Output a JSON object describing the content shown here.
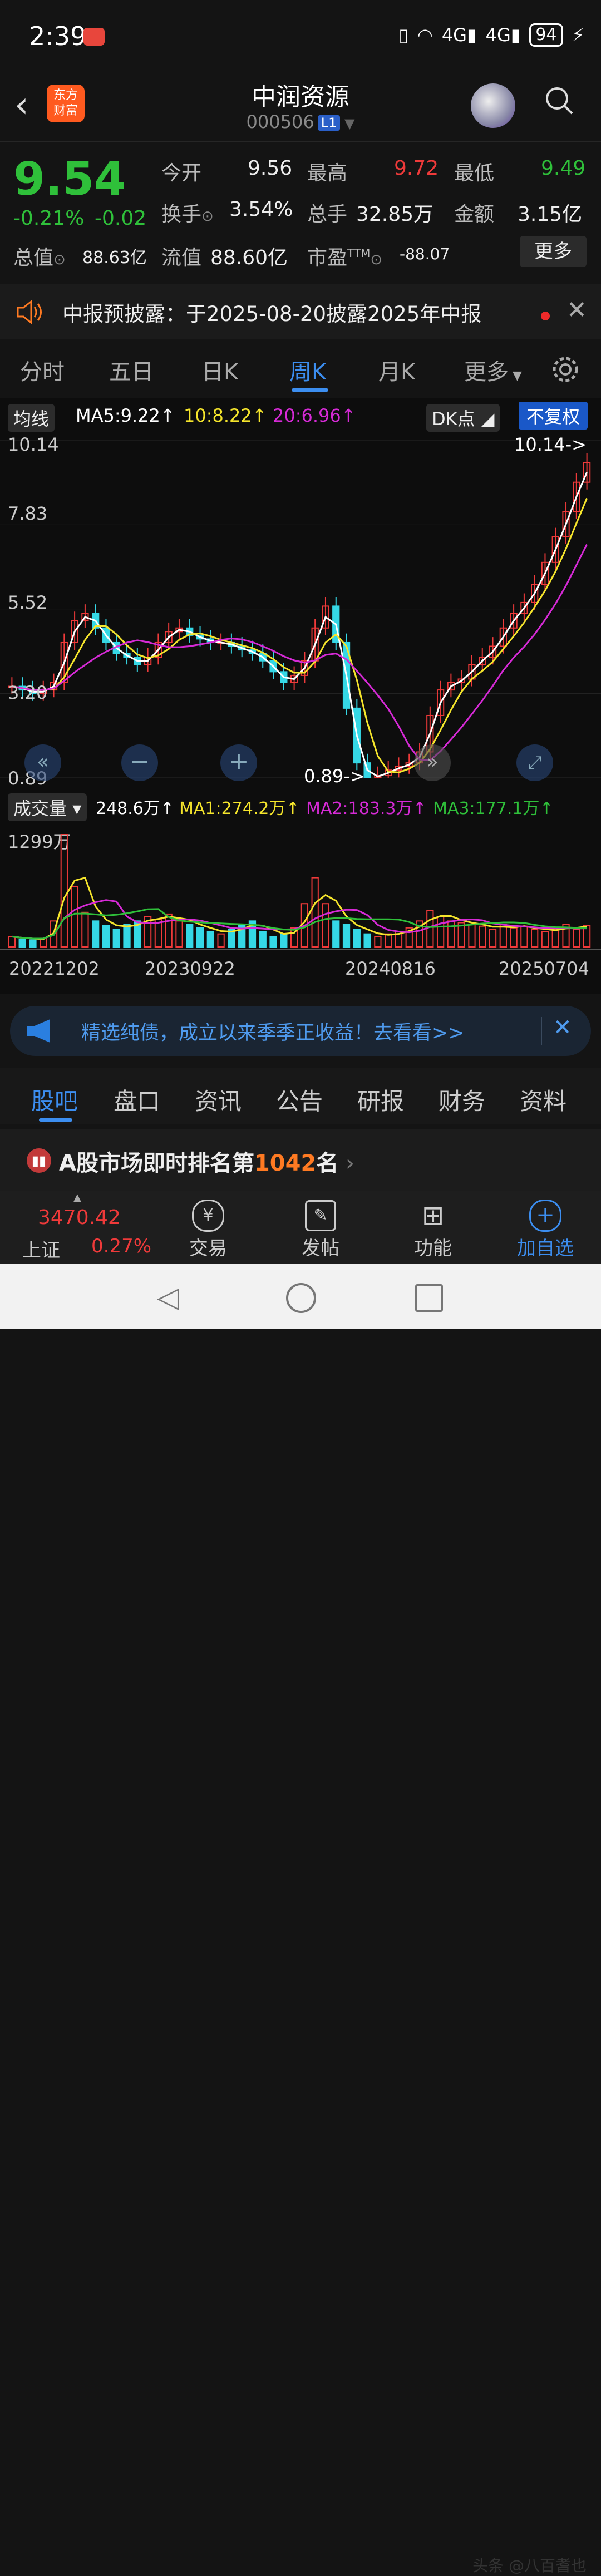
{
  "status_bar": {
    "time": "2:39",
    "battery": "94",
    "signal_a": "4G",
    "signal_b": "4G"
  },
  "header": {
    "logo_line1": "东方",
    "logo_line2": "财富",
    "stock_name": "中润资源",
    "stock_code": "000506",
    "level_badge": "L1"
  },
  "quote": {
    "price": "9.54",
    "change_pct": "-0.21%",
    "change_amt": "-0.02",
    "fields": {
      "open_label": "今开",
      "open": "9.56",
      "high_label": "最高",
      "high": "9.72",
      "low_label": "最低",
      "low": "9.49",
      "turnover_label": "换手",
      "turnover": "3.54%",
      "volume_label": "总手",
      "volume": "32.85万",
      "amount_label": "金额",
      "amount": "3.15亿",
      "mktcap_label": "总值",
      "mktcap": "88.63亿",
      "float_label": "流值",
      "float": "88.60亿",
      "pe_label": "市盈",
      "pe_sup": "TTM",
      "pe": "-88.07"
    },
    "more_button": "更多"
  },
  "notice": {
    "text": "中报预披露：于2025-08-20披露2025年中报"
  },
  "period_tabs": [
    "分时",
    "五日",
    "日K",
    "周K",
    "月K",
    "更多"
  ],
  "ma_bar": {
    "label": "均线",
    "ma5": "MA5:9.22",
    "ma10": "10:8.22",
    "ma20": "20:6.96",
    "dk": "DK点",
    "adjust": "不复权"
  },
  "chart_data": {
    "type": "candlestick",
    "y_ticks": [
      "10.14",
      "7.83",
      "5.52",
      "3.20",
      "0.89"
    ],
    "max_marker": "10.14->",
    "min_marker": "0.89->",
    "x_ticks": [
      "20221202",
      "20230922",
      "20240816",
      "20250704"
    ],
    "volume_ylabel": "1299万",
    "close_path": [
      3.4,
      3.3,
      3.2,
      3.3,
      3.5,
      4.6,
      5.2,
      5.4,
      5.0,
      4.6,
      4.3,
      4.2,
      4.0,
      4.2,
      4.6,
      4.9,
      5.0,
      4.8,
      4.7,
      4.6,
      4.6,
      4.5,
      4.4,
      4.3,
      4.1,
      3.8,
      3.5,
      3.7,
      4.1,
      5.0,
      5.6,
      4.6,
      2.8,
      1.3,
      0.9,
      0.95,
      1.1,
      1.2,
      1.3,
      1.6,
      2.6,
      3.3,
      3.5,
      3.6,
      4.0,
      4.2,
      4.5,
      5.0,
      5.4,
      5.7,
      6.2,
      6.8,
      7.5,
      8.2,
      9.0,
      9.54
    ],
    "volume_series": [
      120,
      90,
      80,
      100,
      300,
      1299,
      700,
      400,
      300,
      250,
      200,
      260,
      300,
      350,
      320,
      380,
      300,
      260,
      220,
      180,
      150,
      200,
      260,
      300,
      180,
      120,
      150,
      220,
      500,
      800,
      500,
      300,
      260,
      200,
      150,
      120,
      150,
      180,
      220,
      300,
      420,
      350,
      300,
      280,
      260,
      240,
      200,
      260,
      220,
      240,
      200,
      180,
      200,
      260,
      200,
      248.6
    ]
  },
  "volume_bar": {
    "label": "成交量",
    "vol": "248.6万",
    "ma1": "MA1:274.2万",
    "ma2": "MA2:183.3万",
    "ma3": "MA3:177.1万"
  },
  "banner": {
    "text": "精选纯债，成立以来季季正收益！去看看>>"
  },
  "sub_tabs": [
    "股吧",
    "盘口",
    "资讯",
    "公告",
    "研报",
    "财务",
    "资料"
  ],
  "rank": {
    "prefix": "A股市场即时排名第",
    "number": "1042",
    "suffix": "名"
  },
  "bottom_nav": {
    "index_value": "3470.42",
    "index_name": "上证",
    "index_pct": "0.27%",
    "trade": "交易",
    "post": "发帖",
    "func": "功能",
    "add": "加自选"
  },
  "watermark": "头条 @八百耆也",
  "colors": {
    "up": "#ef3a3a",
    "down": "#2fc03a",
    "accent": "#3c8ef0",
    "ma5": "#ffffff",
    "ma10": "#f5e52c",
    "ma20": "#d62ad6"
  }
}
